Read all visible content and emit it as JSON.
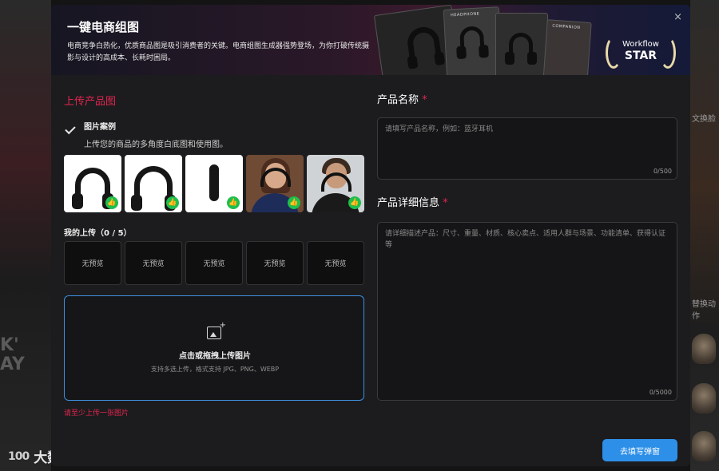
{
  "background": {
    "right_labels": [
      "文换脸",
      "替换动作"
    ],
    "left_big_text": [
      "K'",
      "AY"
    ]
  },
  "watermark": {
    "logo": "100",
    "text": "大数跨境"
  },
  "banner": {
    "title": "一键电商组图",
    "description": "电商竞争白热化，优质商品图是吸引消费者的关键。电商组图生成器强势登场，为你打破传统摄影与设计的高成本、长耗时困局。",
    "collage_tags": [
      "HEADPHONE",
      "COMPANION"
    ],
    "badge_line1": "Workflow",
    "badge_line2": "STAR",
    "close_icon": "×"
  },
  "upload": {
    "section_title": "上传产品图",
    "example_title": "图片案例",
    "example_sub": "上传您的商品的多角度白底图和使用图。",
    "like_icon": "👍",
    "my_upload_label": "我的上传（0 / 5）",
    "slots": [
      "无预览",
      "无预览",
      "无预览",
      "无预览",
      "无预览"
    ],
    "dropzone_title": "点击或拖拽上传图片",
    "dropzone_sub": "支持多选上传，格式支持 JPG、PNG、WEBP",
    "error": "请至少上传一张图片"
  },
  "product": {
    "name_label": "产品名称",
    "name_placeholder": "请填写产品名称，例如：蓝牙耳机",
    "name_count": "0/500",
    "detail_label": "产品详细信息",
    "detail_placeholder": "请详细描述产品：尺寸、重量、材质、核心卖点、适用人群与场景、功能清单、获得认证等",
    "detail_count": "0/5000",
    "required_mark": "*"
  },
  "actions": {
    "submit": "去填写弹窗"
  },
  "colors": {
    "accent_red": "#e0254f",
    "primary_blue": "#2e8fe8",
    "like_green": "#1dbf4d"
  }
}
